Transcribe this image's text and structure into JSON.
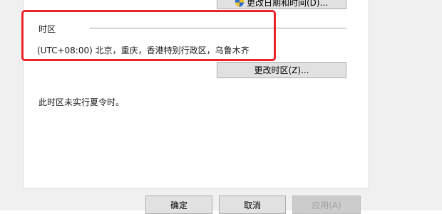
{
  "buttons": {
    "change_datetime": "更改日期和时间(D)...",
    "change_timezone": "更改时区(Z)...",
    "ok": "确定",
    "cancel": "取消",
    "apply": "应用(A)"
  },
  "timezone_group": {
    "label": "时区",
    "value": "(UTC+08:00) 北京，重庆，香港特别行政区，乌鲁木齐"
  },
  "dst_note": "此时区未实行夏令时。",
  "colors": {
    "highlight": "#e8242a",
    "dialog_bg": "#f0f0f0",
    "panel_bg": "#ffffff",
    "button_bg": "#e1e1e1"
  },
  "icons": {
    "uac": "uac-shield-icon"
  }
}
